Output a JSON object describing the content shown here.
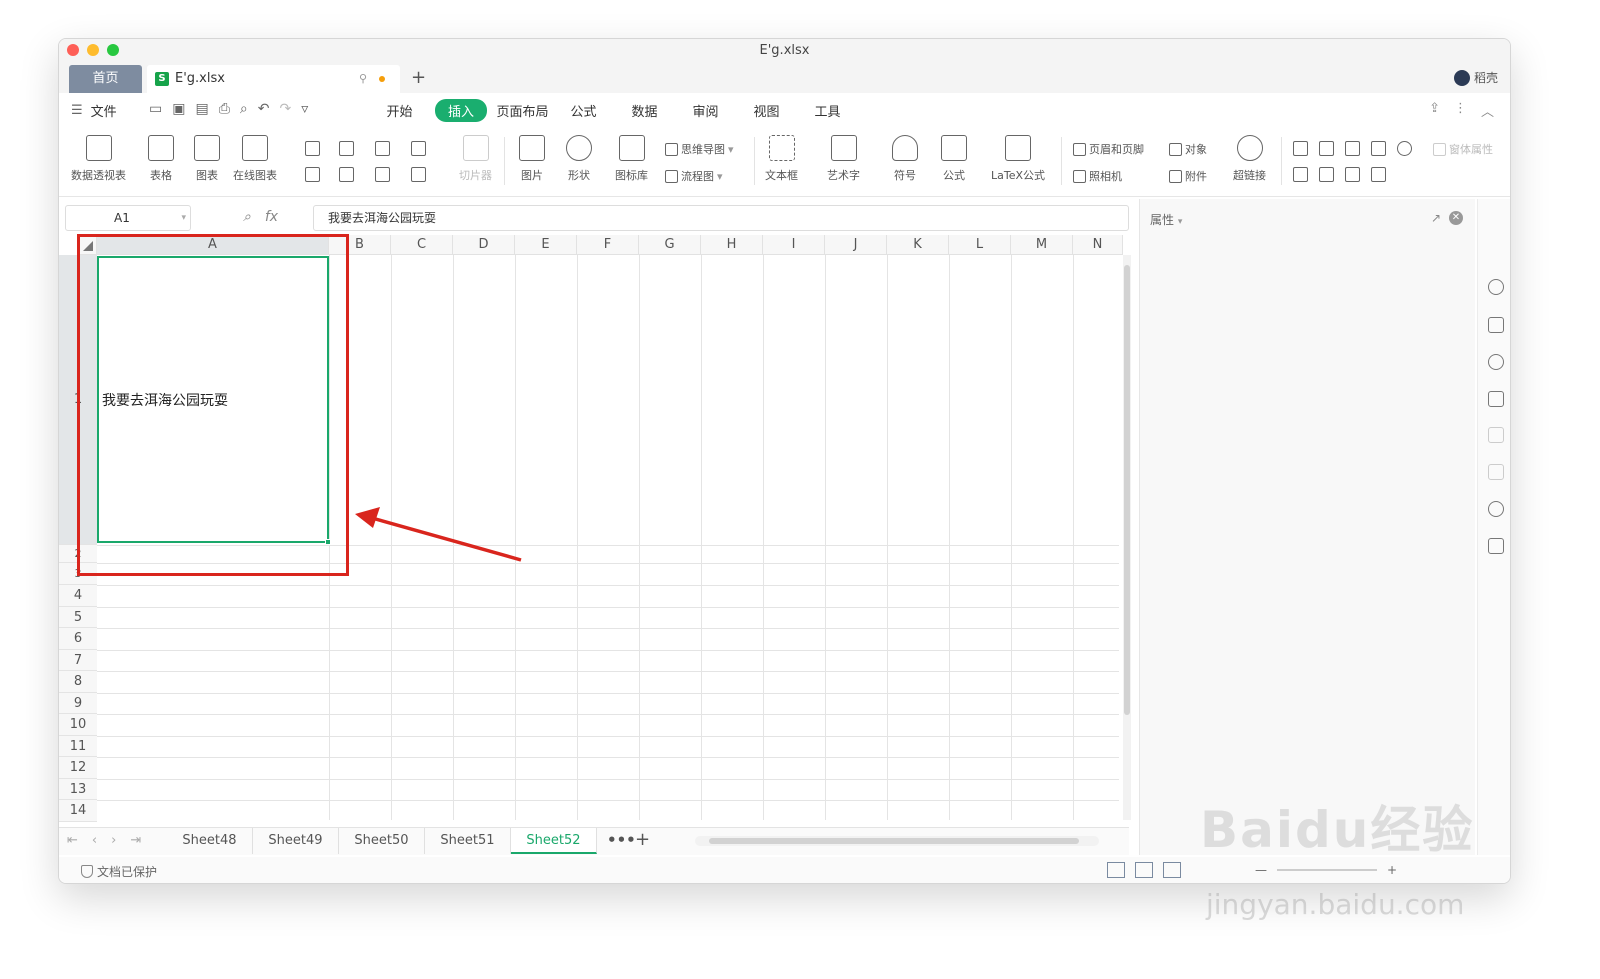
{
  "window": {
    "title": "E'g.xlsx"
  },
  "tabs": {
    "home": "首页",
    "file": "E'g.xlsx",
    "user": "稻壳"
  },
  "menu": {
    "file": "文件",
    "items": [
      "开始",
      "插入",
      "页面布局",
      "公式",
      "数据",
      "审阅",
      "视图",
      "工具"
    ],
    "active": "插入"
  },
  "ribbon": {
    "pivot": "数据透视表",
    "table": "表格",
    "chart": "图表",
    "online_chart": "在线图表",
    "slicer": "切片器",
    "picture": "图片",
    "shape": "形状",
    "icon_lib": "图标库",
    "mindmap": "思维导图",
    "flowchart": "流程图",
    "textbox": "文本框",
    "wordart": "艺术字",
    "symbol": "符号",
    "formula": "公式",
    "latex": "LaTeX公式",
    "header_footer": "页眉和页脚",
    "object": "对象",
    "camera": "照相机",
    "attachment": "附件",
    "hyperlink": "超链接",
    "form_props": "窗体属性"
  },
  "formula_bar": {
    "name_box": "A1",
    "fx": "fx",
    "content": "我要去洱海公园玩耍"
  },
  "grid": {
    "columns": [
      "A",
      "B",
      "C",
      "D",
      "E",
      "F",
      "G",
      "H",
      "I",
      "J",
      "K",
      "L",
      "M",
      "N"
    ],
    "rows": [
      "1",
      "2",
      "3",
      "4",
      "5",
      "6",
      "7",
      "8",
      "9",
      "10",
      "11",
      "12",
      "13",
      "14"
    ],
    "selected_cell": "A1",
    "a1_value": "我要去洱海公园玩耍"
  },
  "sheet_tabs": [
    "Sheet48",
    "Sheet49",
    "Sheet50",
    "Sheet51",
    "Sheet52"
  ],
  "active_sheet": "Sheet52",
  "sheet_more": "•••",
  "sheet_add": "+",
  "status": {
    "protection": "文档已保护"
  },
  "properties_panel": {
    "title": "属性"
  },
  "annotation": {
    "color": "#d9251d"
  },
  "accent_color": "#1aae6f",
  "watermark": {
    "main": "Baidu经验",
    "sub": "jingyan.baidu.com"
  }
}
